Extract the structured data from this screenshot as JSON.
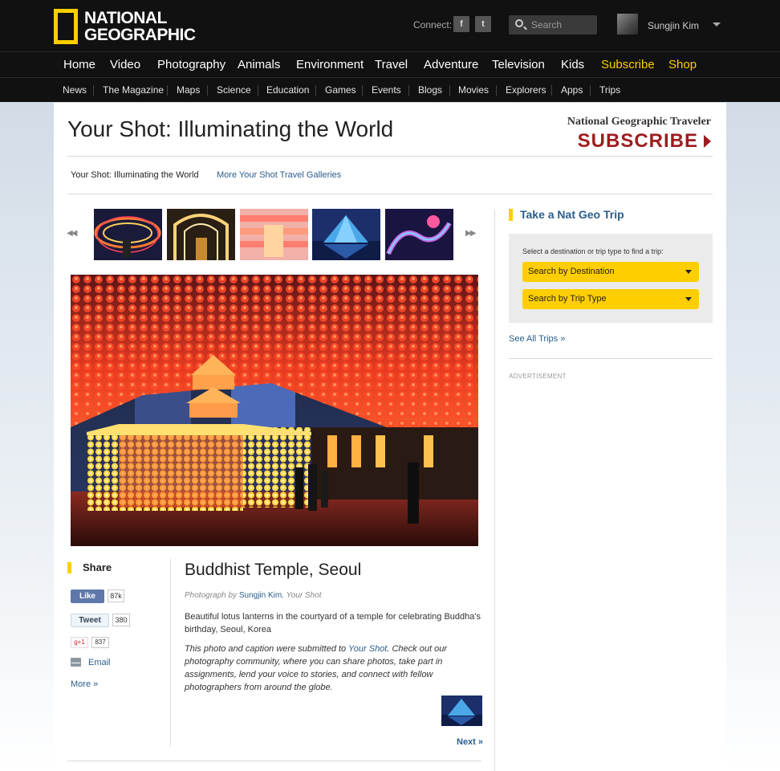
{
  "header": {
    "logo_text": "NATIONAL GEOGRAPHIC",
    "connect_label": "Connect:",
    "social": [
      {
        "icon": "facebook-icon",
        "glyph": "f"
      },
      {
        "icon": "twitter-icon",
        "glyph": "t"
      }
    ],
    "search_placeholder": "Search",
    "user_name": "Sungjin Kim"
  },
  "main_nav": [
    "Home",
    "Video",
    "Photography",
    "Animals",
    "Environment",
    "Travel",
    "Adventure",
    "Television",
    "Kids",
    "Subscribe",
    "Shop"
  ],
  "sub_nav": [
    "News",
    "The Magazine",
    "Maps",
    "Science",
    "Education",
    "Games",
    "Events",
    "Blogs",
    "Movies",
    "Explorers",
    "Apps",
    "Trips"
  ],
  "page": {
    "title": "Your Shot: Illuminating the World",
    "promo_brand": "National Geographic Traveler",
    "promo_cta": "SUBSCRIBE",
    "breadcrumb_current": "Your Shot: Illuminating the World",
    "breadcrumb_link": "More Your Shot Travel Galleries"
  },
  "gallery": {
    "prev_glyph": "◀◀",
    "next_glyph": "▶▶",
    "thumbnail_count": 5
  },
  "photo": {
    "title": "Buddhist Temple, Seoul",
    "credit_prefix": "Photograph by",
    "credit_author": "Sungjin Kim",
    "credit_suffix": ", Your Shot",
    "caption": "Beautiful lotus lanterns in the courtyard of a temple for celebrating Buddha's birthday, Seoul, Korea",
    "submitted_prefix": "This photo and caption were submitted to",
    "submitted_link": "Your Shot",
    "submitted_suffix": ". Check out our photography community, where you can share photos, take part in assignments, lend your voice to stories, and connect with fellow photographers from around the globe.",
    "next_label": "Next »"
  },
  "share": {
    "heading": "Share",
    "like_label": "Like",
    "like_count": "87k",
    "tweet_label": "Tweet",
    "tweet_count": "380",
    "gplus_label": "g+1",
    "gplus_count": "837",
    "email_label": "Email",
    "more_label": "More »"
  },
  "sidebar": {
    "trip_heading": "Take a Nat Geo Trip",
    "trip_prompt": "Select a destination or trip type to find a trip:",
    "select_destination": "Search by Destination",
    "select_trip_type": "Search by Trip Type",
    "see_all": "See All Trips »",
    "ad_label": "ADVERTISEMENT"
  },
  "colors": {
    "brand_yellow": "#ffce00",
    "link_blue": "#2a5d8c",
    "subscribe_red": "#9e1c1f",
    "nav_bg": "#111111"
  }
}
